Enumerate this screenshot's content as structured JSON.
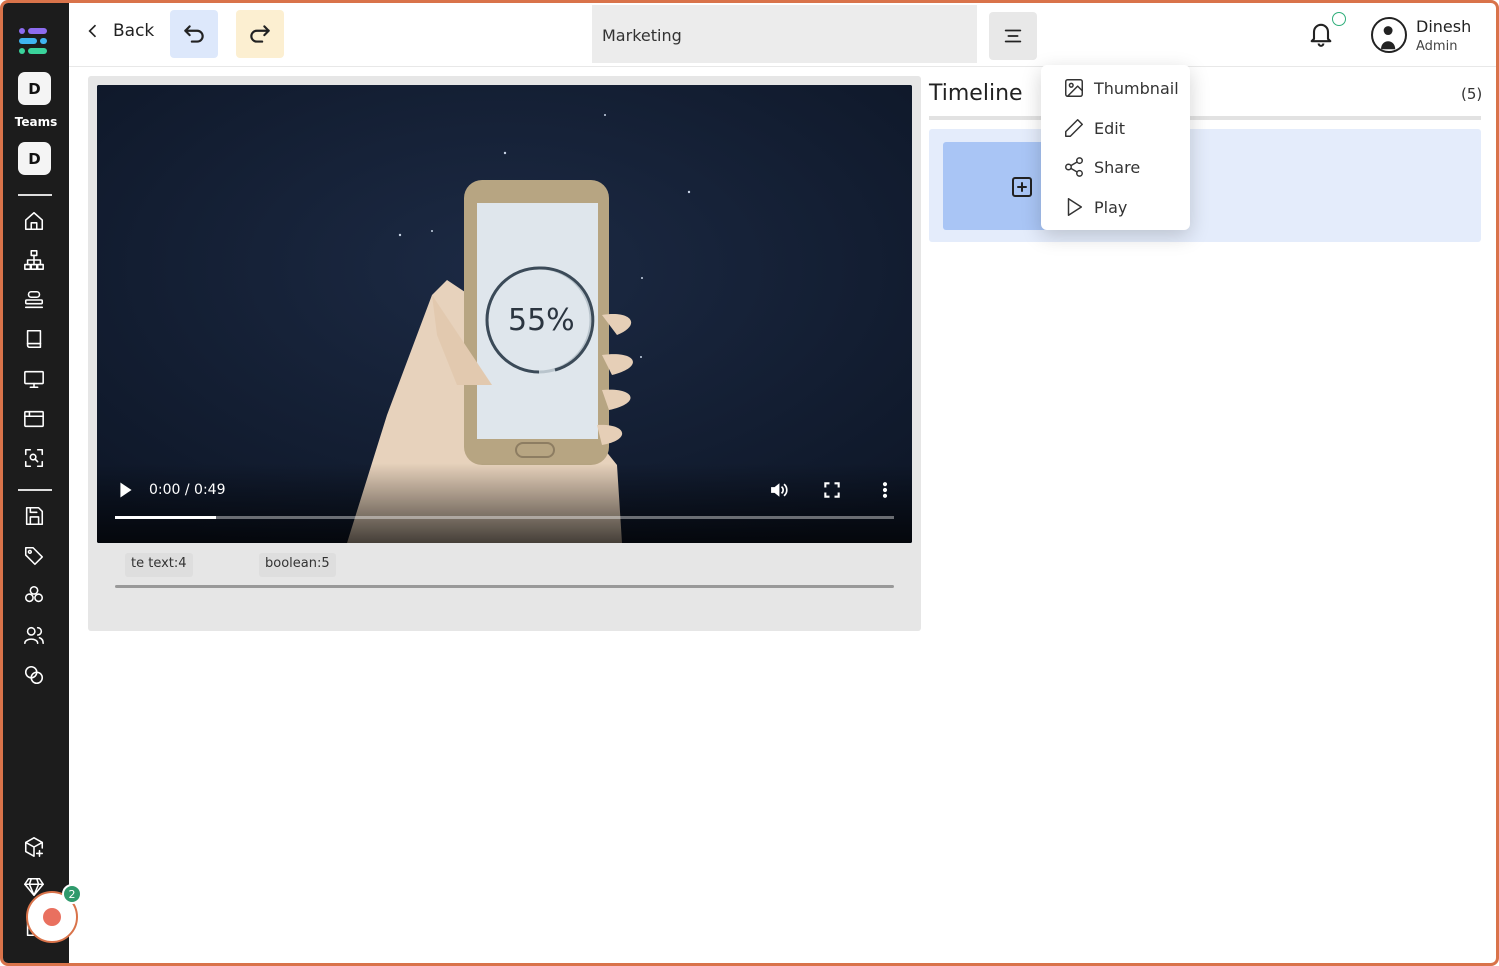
{
  "sidebar": {
    "team_badge_top": "D",
    "teams_label": "Teams",
    "team_badge": "D",
    "icons": [
      "home-icon",
      "org-chart-icon",
      "stack-icon",
      "book-icon",
      "monitor-icon",
      "window-icon",
      "scan-search-icon",
      "save-icon",
      "tag-icon",
      "cubes-icon",
      "users-icon",
      "coins-icon",
      "box-plus-icon",
      "diamond-icon"
    ],
    "recorder_count": "2"
  },
  "header": {
    "back_label": "Back",
    "title": "Marketing",
    "undo_bg": "#dde8fb",
    "redo_bg": "#fcefd1",
    "user_name": "Dinesh",
    "user_role": "Admin"
  },
  "video": {
    "time": "0:00 / 0:49",
    "phone_percent": "55%",
    "progress": 0.13
  },
  "tags": [
    "te text:4",
    "boolean:5"
  ],
  "timeline": {
    "title": "Timeline",
    "count": "(5)"
  },
  "dropdown": {
    "items": [
      {
        "label": "Thumbnail",
        "icon": "image-icon"
      },
      {
        "label": "Edit",
        "icon": "pencil-icon"
      },
      {
        "label": "Share",
        "icon": "share-icon"
      },
      {
        "label": "Play",
        "icon": "play-icon"
      }
    ]
  },
  "colors": {
    "sidebar": "#1c1c1c",
    "frame": "#d9734a",
    "accent_blue": "#a9c5f5",
    "recorder": "#e9705f",
    "badge_green": "#2f9a6c"
  }
}
